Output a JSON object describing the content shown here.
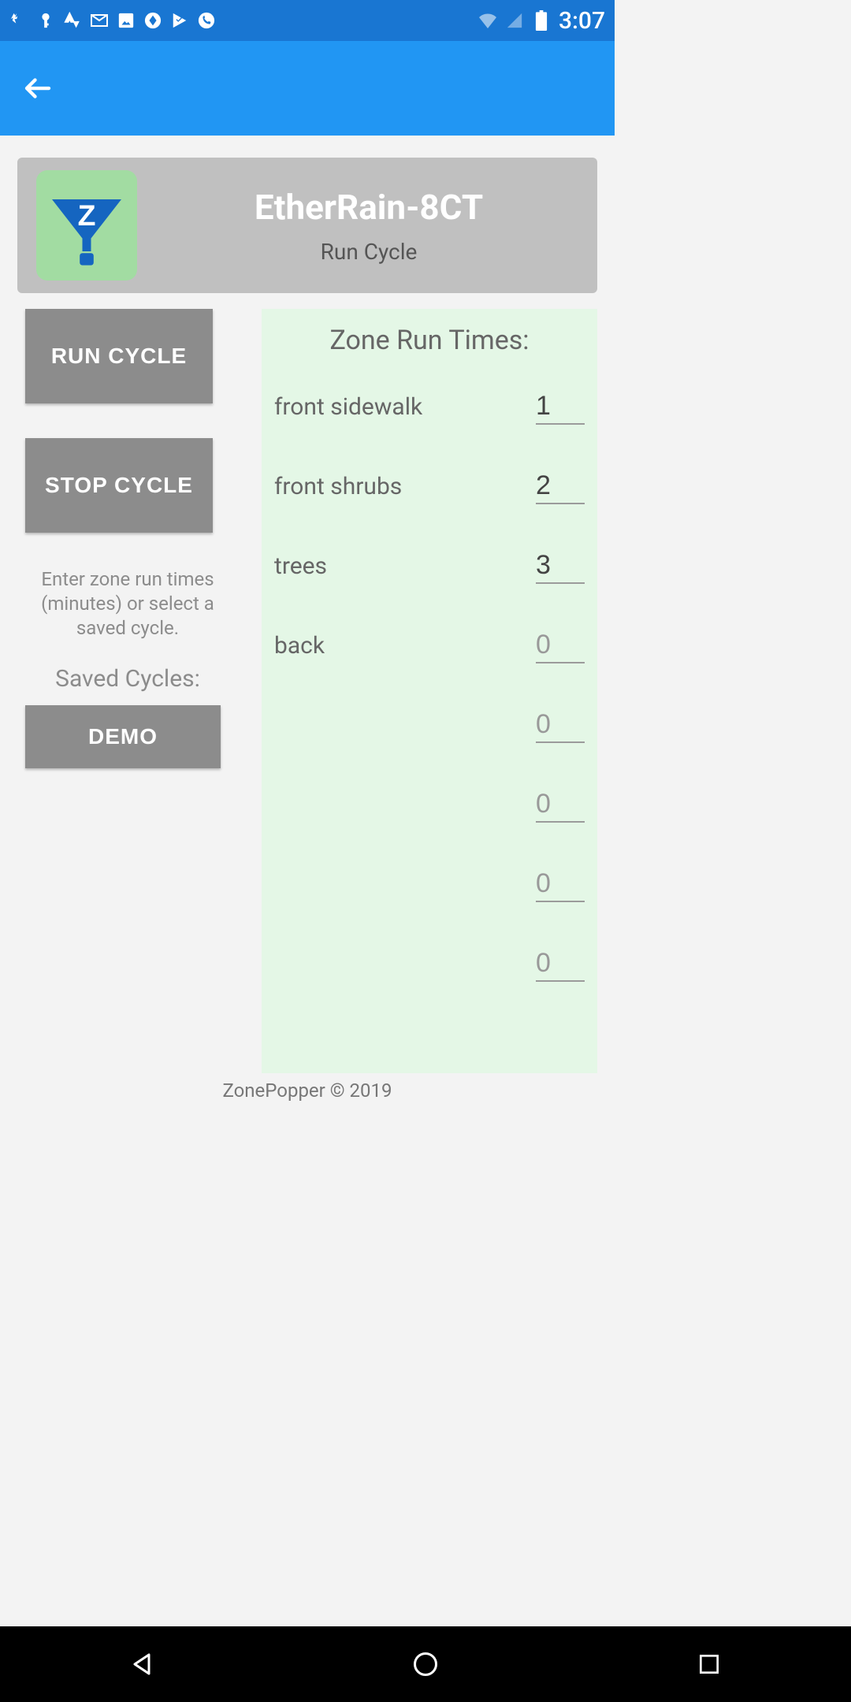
{
  "status": {
    "time": "3:07"
  },
  "header": {
    "device_name": "EtherRain-8CT",
    "subtitle": "Run Cycle"
  },
  "buttons": {
    "run_cycle": "RUN CYCLE",
    "stop_cycle": "STOP CYCLE",
    "demo": "DEMO"
  },
  "labels": {
    "help_text": "Enter zone run times (minutes) or select a saved cycle.",
    "saved_cycles": "Saved Cycles:",
    "panel_title": "Zone Run Times:"
  },
  "zones": [
    {
      "label": "front sidewalk",
      "value": "1",
      "has_value": true
    },
    {
      "label": "front shrubs",
      "value": "2",
      "has_value": true
    },
    {
      "label": "trees",
      "value": "3",
      "has_value": true
    },
    {
      "label": "back",
      "value": "0",
      "has_value": false
    },
    {
      "label": "",
      "value": "0",
      "has_value": false
    },
    {
      "label": "",
      "value": "0",
      "has_value": false
    },
    {
      "label": "",
      "value": "0",
      "has_value": false
    },
    {
      "label": "",
      "value": "0",
      "has_value": false
    }
  ],
  "footer": "ZonePopper © 2019"
}
